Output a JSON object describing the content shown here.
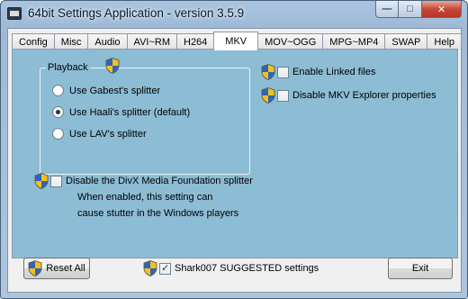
{
  "window": {
    "title": "64bit Settings Application - version 3.5.9",
    "minimize_glyph": "—",
    "maximize_glyph": "□",
    "close_glyph": "✕"
  },
  "tabs": [
    {
      "label": "Config"
    },
    {
      "label": "Misc"
    },
    {
      "label": "Audio"
    },
    {
      "label": "AVI~RM"
    },
    {
      "label": "H264"
    },
    {
      "label": "MKV",
      "active": true
    },
    {
      "label": "MOV~OGG"
    },
    {
      "label": "MPG~MP4"
    },
    {
      "label": "SWAP"
    },
    {
      "label": "Help"
    }
  ],
  "playback": {
    "label": "Playback",
    "options": [
      {
        "label": "Use Gabest's splitter",
        "selected": false
      },
      {
        "label": "Use Haali's splitter (default)",
        "selected": true
      },
      {
        "label": "Use LAV's splitter",
        "selected": false
      }
    ]
  },
  "right_options": [
    {
      "label": "Enable Linked files",
      "checked": false
    },
    {
      "label": "Disable MKV Explorer properties",
      "checked": false
    }
  ],
  "divx": {
    "label": "Disable the DivX Media Foundation splitter",
    "checked": false,
    "note_line1": "When enabled, this setting can",
    "note_line2": "cause stutter in the Windows players"
  },
  "footer": {
    "reset_label": "Reset All",
    "suggested_label": "Shark007 SUGGESTED settings",
    "suggested_checked": true,
    "exit_label": "Exit"
  },
  "colors": {
    "panel": "#8dbcd5",
    "shield_blue": "#2f64b8",
    "shield_yellow": "#f2c21b"
  },
  "icons": {
    "shield": "uac-shield-icon",
    "app": "app-icon"
  }
}
